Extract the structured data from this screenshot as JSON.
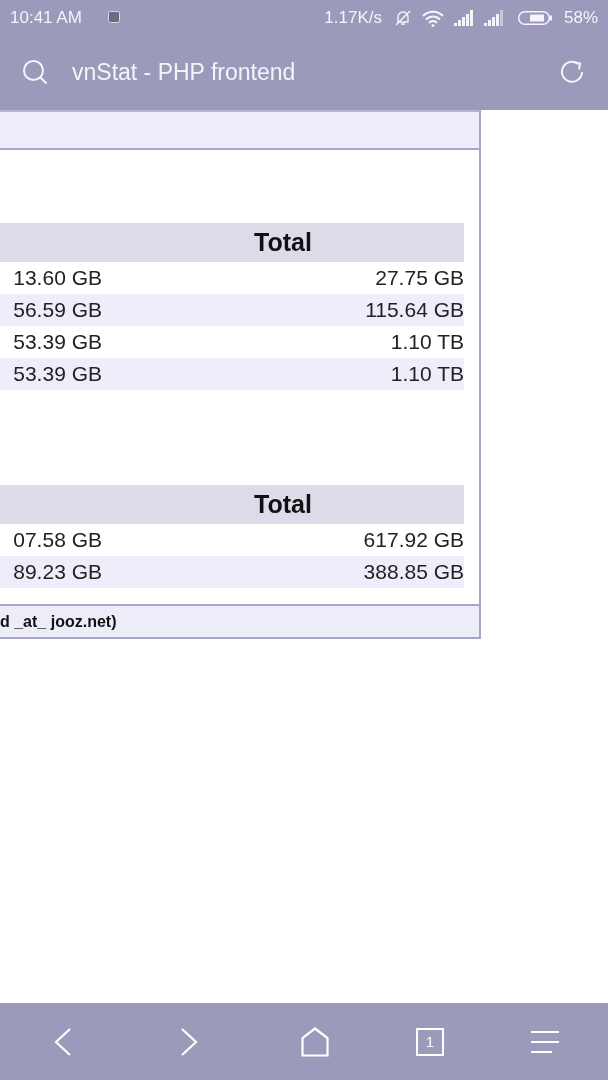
{
  "status_bar": {
    "time": "10:41 AM",
    "net_speed": "1.17K/s",
    "battery": "58%"
  },
  "toolbar": {
    "title": "vnStat - PHP frontend"
  },
  "tables": [
    {
      "header": "Total",
      "rows": [
        [
          "13.60 GB",
          "27.75 GB"
        ],
        [
          "56.59 GB",
          "115.64 GB"
        ],
        [
          "53.39 GB",
          "1.10 TB"
        ],
        [
          "53.39 GB",
          "1.10 TB"
        ]
      ]
    },
    {
      "header": "Total",
      "rows": [
        [
          "07.58 GB",
          "617.92 GB"
        ],
        [
          "89.23 GB",
          "388.85 GB"
        ]
      ]
    }
  ],
  "footer": "d _at_ jooz.net)",
  "nav_bar": {
    "tab_count": "1"
  }
}
